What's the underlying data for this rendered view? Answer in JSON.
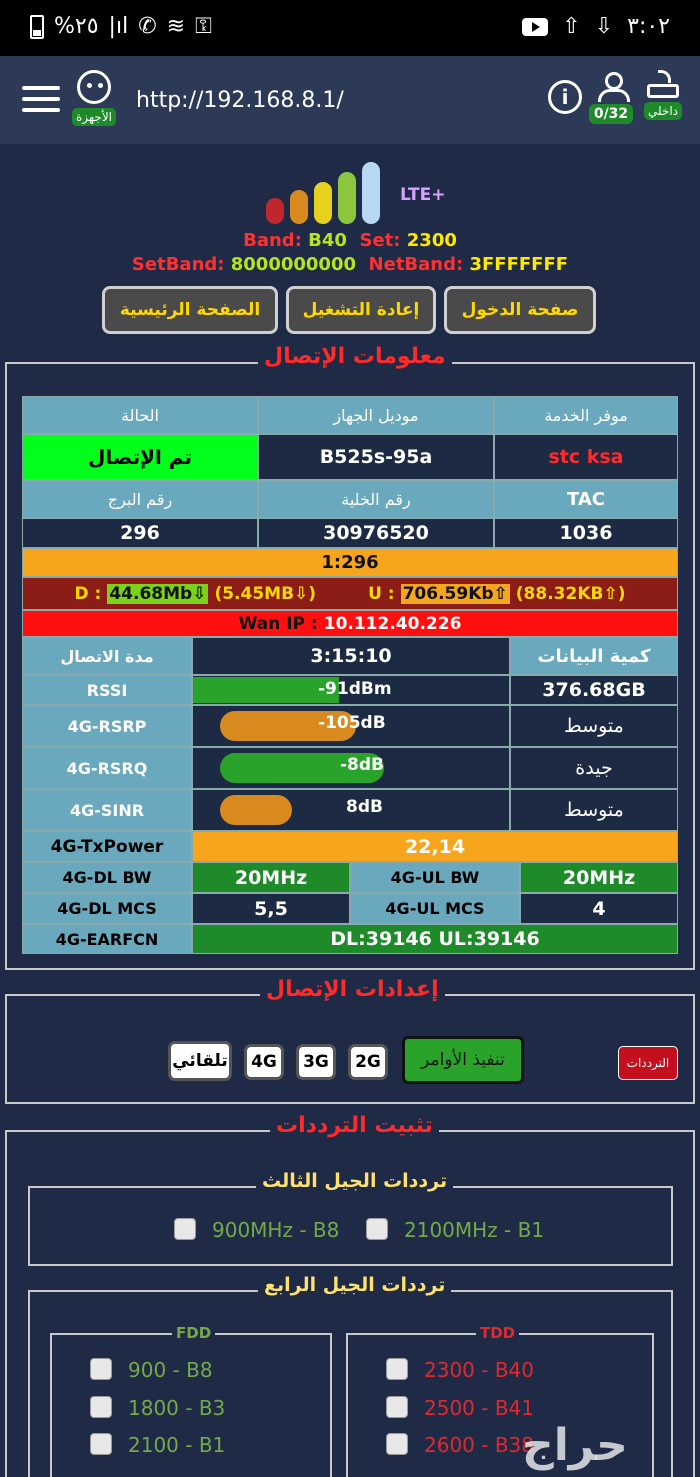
{
  "status_bar": {
    "battery": "%٢٥",
    "time": "٣:٠٢"
  },
  "header": {
    "url": "http://192.168.8.1/",
    "devices_label": "الأجهزة",
    "users_count": "0/32",
    "router_label": "داخلي",
    "info_icon": "i"
  },
  "signal": {
    "network": "LTE+",
    "band_label": "Band:",
    "band_value": "B40",
    "set_label": "Set:",
    "set_value": "2300",
    "setband_label": "SetBand:",
    "setband_value": "8000000000",
    "netband_label": "NetBand:",
    "netband_value": "3FFFFFFF",
    "bar_colors": [
      "#c0272d",
      "#d98a1e",
      "#e6d21c",
      "#8cc63f",
      "#b7d8f3"
    ]
  },
  "nav": {
    "home": "الصفحة الرئيسية",
    "reboot": "إعادة التشغيل",
    "login": "صفحة الدخول"
  },
  "connection": {
    "title": "معلومات الإتصال",
    "headers": {
      "status": "الحالة",
      "model": "موديل الجهاز",
      "provider": "موفر الخدمة",
      "tower": "رقم البرج",
      "cell": "رقم الخلية",
      "tac": "TAC"
    },
    "values": {
      "status": "تم الإتصال",
      "model": "B525s-95a",
      "provider": "stc ksa",
      "tower": "296",
      "cell": "30976520",
      "tac": "1036"
    },
    "cell_id_line": "1:296",
    "traffic": {
      "d_label": "D :",
      "d_rate": "44.68Mb⇩",
      "d_total": "(5.45MB⇩)",
      "u_label": "U :",
      "u_rate": "706.59Kb⇧",
      "u_total": "(88.32KB⇧)"
    },
    "wan_label": "Wan IP :",
    "wan_ip": "10.112.40.226",
    "duration_label": "مدة الاتصال",
    "duration": "3:15:10",
    "data_label": "كمية البيانات",
    "data_amount": "376.68GB",
    "rssi_label": "RSSI",
    "rssi": "-91dBm",
    "rsrp_label": "4G-RSRP",
    "rsrp": "-105dB",
    "rsrp_quality": "متوسط",
    "rsrq_label": "4G-RSRQ",
    "rsrq": "-8dB",
    "rsrq_quality": "جيدة",
    "sinr_label": "4G-SINR",
    "sinr": "8dB",
    "sinr_quality": "متوسط",
    "txpower_label": "4G-TxPower",
    "txpower": "22,14",
    "dlbw_label": "4G-DL BW",
    "dlbw": "20MHz",
    "ulbw_label": "4G-UL BW",
    "ulbw": "20MHz",
    "dlmcs_label": "4G-DL MCS",
    "dlmcs": "5,5",
    "ulmcs_label": "4G-UL MCS",
    "ulmcs": "4",
    "earfcn_label": "4G-EARFCN",
    "earfcn": "DL:39146 UL:39146"
  },
  "settings": {
    "title": "إعدادات الإتصال",
    "auto": "تلقائي",
    "g4": "4G",
    "g3": "3G",
    "g2": "2G",
    "execute": "تنفيذ الأوامر",
    "frequencies": "الترددات"
  },
  "lock": {
    "title": "تثبيت الترددات",
    "g3_title": "ترددات الجيل الثالث",
    "g3_items": [
      "900MHz - B8",
      "2100MHz - B1"
    ],
    "g4_title": "ترددات الجيل الرابع",
    "fdd_label": "FDD",
    "tdd_label": "TDD",
    "fdd_items": [
      "900 - B8",
      "1800 - B3",
      "2100 - B1"
    ],
    "tdd_items": [
      "2300 - B40",
      "2500 - B41",
      "2600 - B38"
    ]
  },
  "watermark": "حراج"
}
